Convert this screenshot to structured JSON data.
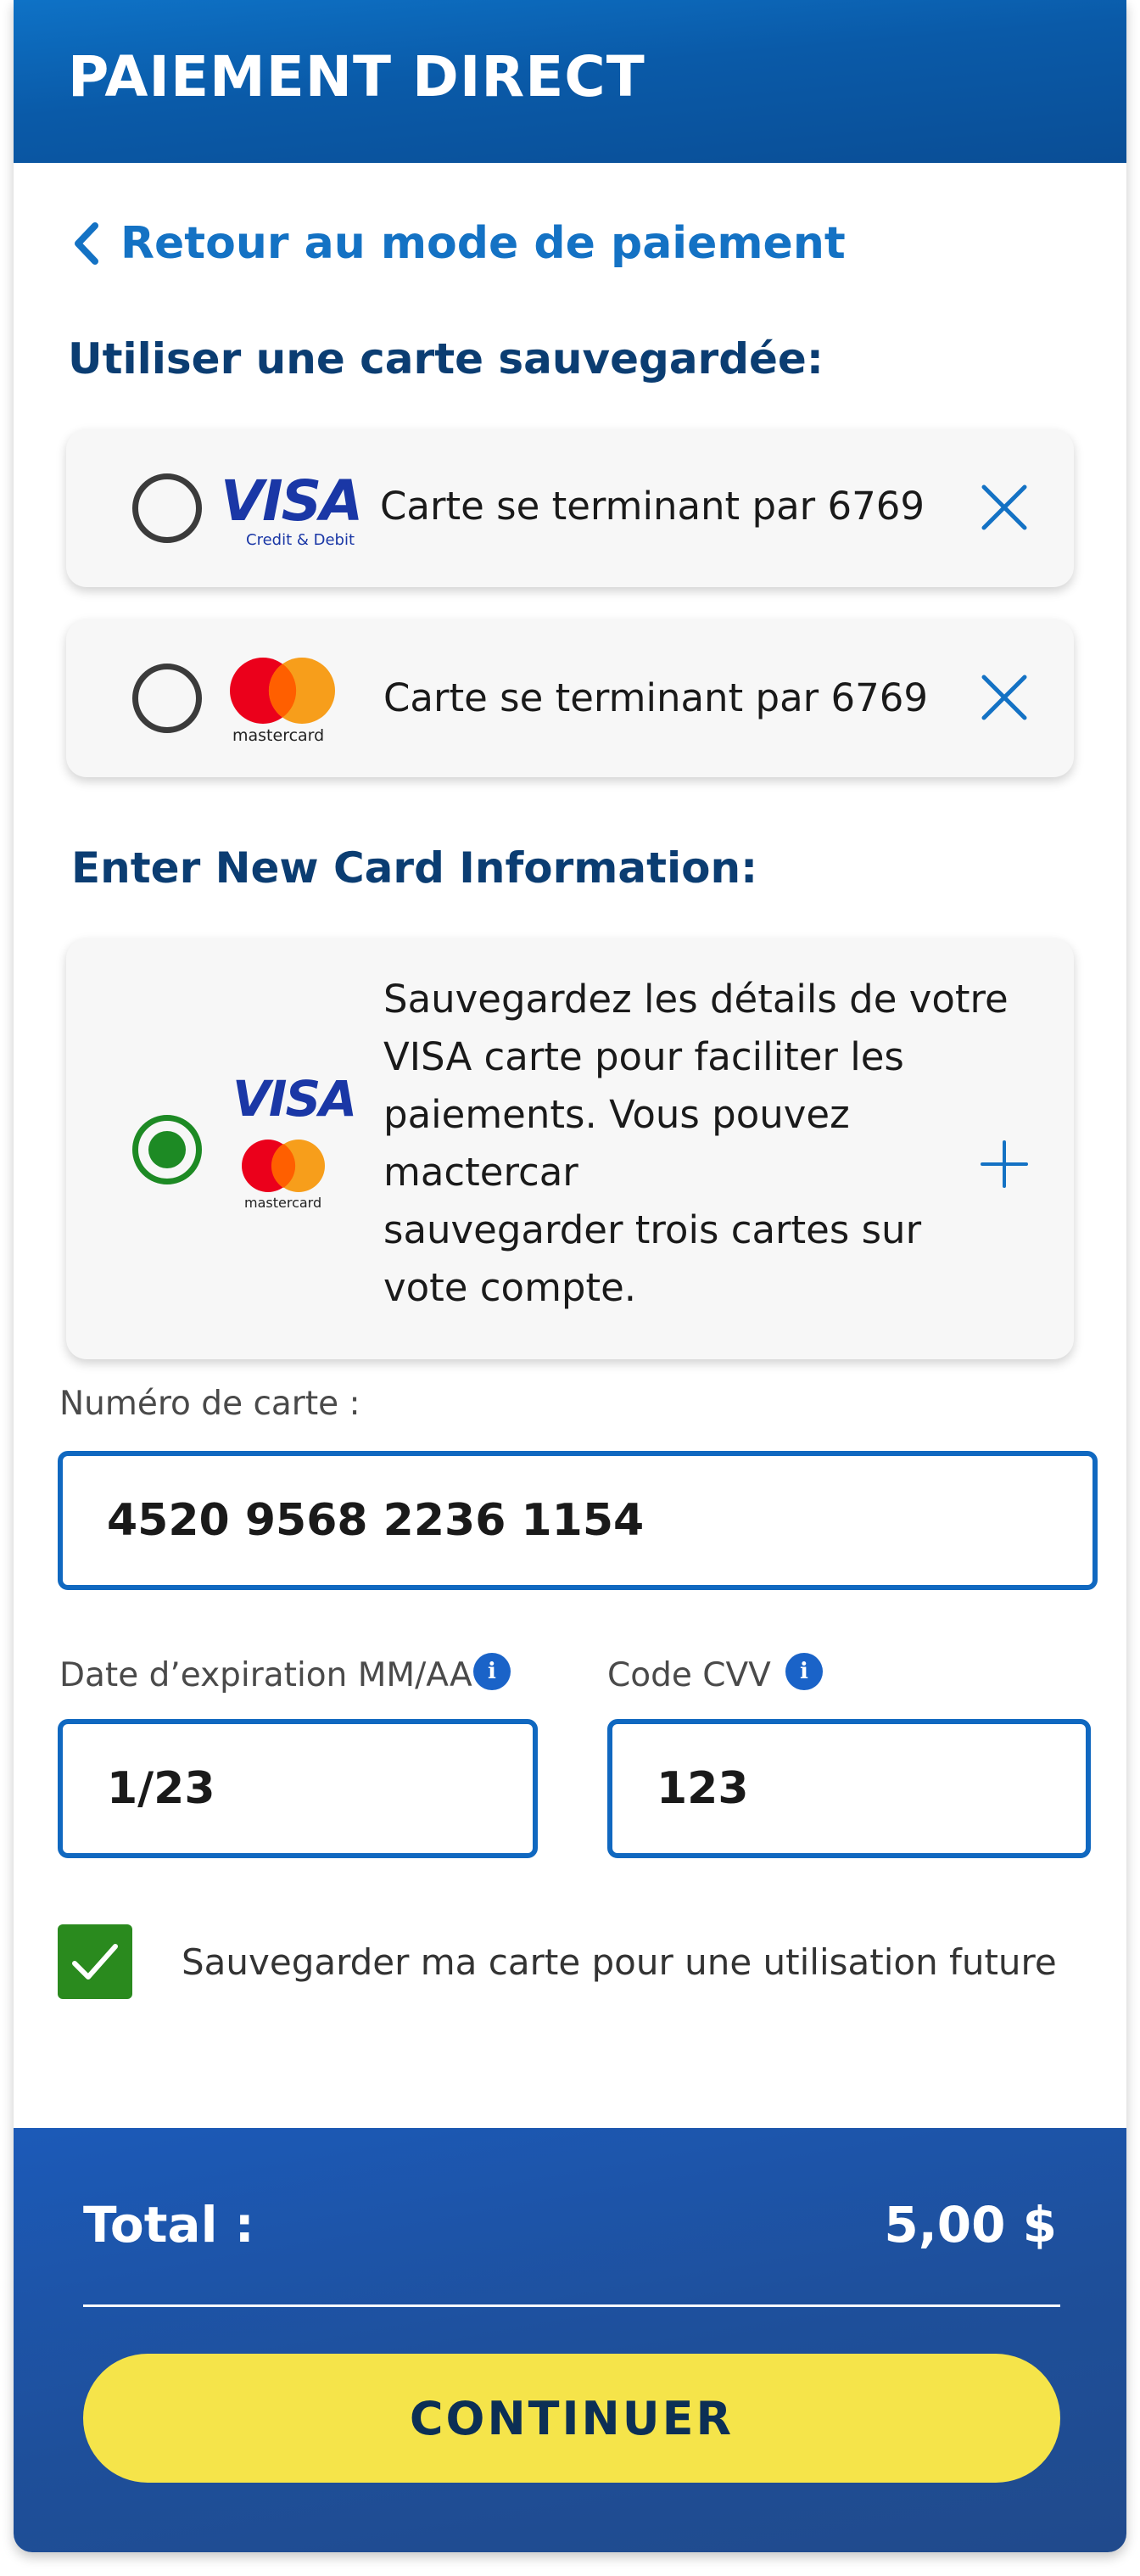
{
  "header": {
    "title": "PAIEMENT DIRECT"
  },
  "navigation": {
    "back_label": "Retour au mode de paiement"
  },
  "saved_cards": {
    "title": "Utiliser une carte sauvegardée:",
    "items": [
      {
        "brand": "visa",
        "brand_label": "VISA",
        "brand_sub": "Credit & Debit",
        "label": "Carte se terminant par 6769",
        "selected": false
      },
      {
        "brand": "mastercard",
        "brand_label": "mastercard",
        "label": "Carte se terminant par 6769",
        "selected": false
      }
    ]
  },
  "new_card": {
    "title": "Enter New Card Information:",
    "selected": true,
    "visa_label": "VISA",
    "mastercard_label": "mastercard",
    "description_lines": [
      "Sauvegardez les détails de votre",
      "VISA carte pour faciliter les",
      "paiements. Vous pouvez",
      "mactercar",
      "sauvegarder trois cartes sur",
      "vote compte."
    ]
  },
  "form": {
    "card_number": {
      "label": "Numéro de carte :",
      "value": "4520 9568 2236 1154"
    },
    "expiry": {
      "label": "Date d’expiration MM/AA",
      "value": "1/23",
      "info_glyph": "i"
    },
    "cvv": {
      "label": "Code CVV",
      "value": "123",
      "info_glyph": "i"
    },
    "save_card": {
      "label": "Sauvegarder ma carte pour une utilisation future",
      "checked": true
    }
  },
  "footer": {
    "total_label": "Total :",
    "total_value": "5,00 $",
    "continue_label": "CONTINUER"
  },
  "colors": {
    "header_blue": "#0a5aa8",
    "link_blue": "#1472c4",
    "title_navy": "#0b3d72",
    "input_border": "#1068c0",
    "radio_selected": "#1d8a24",
    "checkbox_green": "#2a8a1e",
    "footer_blue": "#1e4f9a",
    "button_yellow": "#f5e44a",
    "mastercard_red": "#eb001b",
    "mastercard_orange": "#f79e1b"
  }
}
